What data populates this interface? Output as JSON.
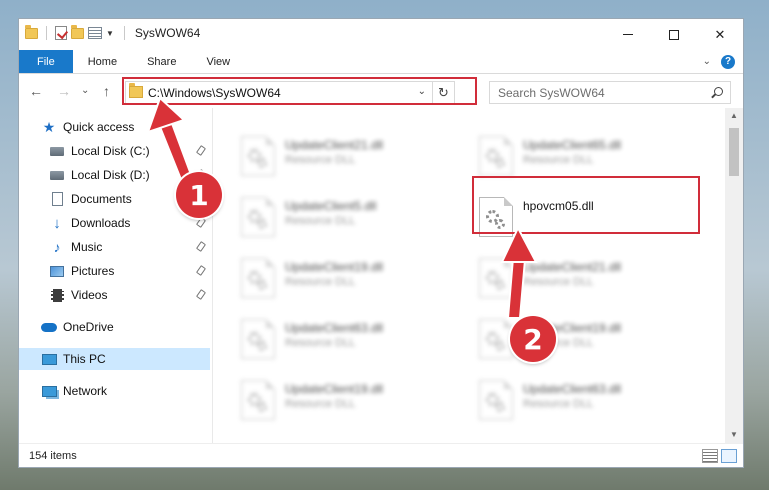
{
  "window": {
    "title": "SysWOW64",
    "controls": {
      "minimize": "—",
      "maximize": "",
      "close": "✕"
    }
  },
  "ribbon": {
    "tabs": [
      {
        "label": "File",
        "active": true
      },
      {
        "label": "Home"
      },
      {
        "label": "Share"
      },
      {
        "label": "View"
      }
    ],
    "help": "?"
  },
  "nav": {
    "back": "←",
    "forward": "→",
    "recent": "⌄",
    "up": "↑",
    "address": "C:\\Windows\\SysWOW64",
    "address_dropdown": "⌄",
    "refresh": "↻",
    "search_placeholder": "Search SysWOW64"
  },
  "sidebar": {
    "items": [
      {
        "label": "Quick access",
        "icon": "star-icon"
      },
      {
        "label": "Local Disk (C:)",
        "icon": "disk-icon",
        "pinned": true
      },
      {
        "label": "Local Disk (D:)",
        "icon": "disk-icon",
        "pinned": true
      },
      {
        "label": "Documents",
        "icon": "document-icon",
        "pinned": true
      },
      {
        "label": "Downloads",
        "icon": "download-icon",
        "pinned": true
      },
      {
        "label": "Music",
        "icon": "music-icon",
        "pinned": true
      },
      {
        "label": "Pictures",
        "icon": "pictures-icon",
        "pinned": true
      },
      {
        "label": "Videos",
        "icon": "video-icon",
        "pinned": true
      },
      {
        "label": "OneDrive",
        "icon": "cloud-icon"
      },
      {
        "label": "This PC",
        "icon": "pc-icon",
        "active": true
      },
      {
        "label": "Network",
        "icon": "network-icon"
      }
    ]
  },
  "files": [
    {
      "name": "UpdateClient21.dll",
      "type": "Resource DLL"
    },
    {
      "name": "UpdateClient65.dll",
      "type": "Resource DLL"
    },
    {
      "name": "UpdateClient5.dll",
      "type": "Resource DLL"
    },
    {
      "name": "hpovcm05.dll",
      "type": "",
      "highlighted": true
    },
    {
      "name": "UpdateClient19.dll",
      "type": "Resource DLL"
    },
    {
      "name": "UpdateClient21.dll",
      "type": "Resource DLL"
    },
    {
      "name": "UpdateClient63.dll",
      "type": "Resource DLL"
    },
    {
      "name": "UpdateClient19.dll",
      "type": "Resource DLL"
    },
    {
      "name": "UpdateClient19.dll",
      "type": "Resource DLL"
    },
    {
      "name": "UpdateClient63.dll",
      "type": "Resource DLL"
    }
  ],
  "status": {
    "item_count": "154 items"
  },
  "annotations": {
    "step1": "1",
    "step2": "2",
    "highlight_color": "#d12d3a"
  },
  "colors": {
    "accent": "#1979ca",
    "selected": "#cce8ff"
  }
}
